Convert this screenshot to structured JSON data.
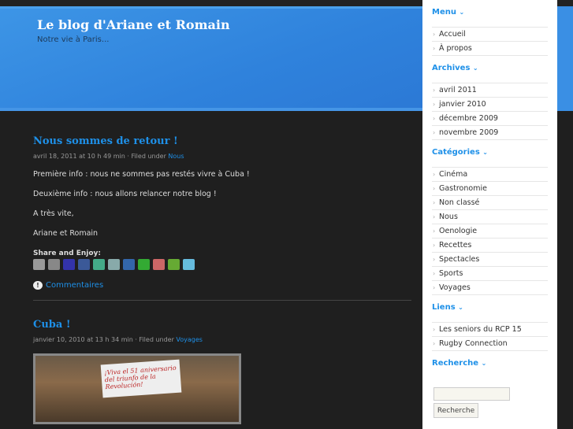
{
  "header": {
    "title": "Le blog d'Ariane et Romain",
    "tagline": "Notre vie à Paris..."
  },
  "posts": [
    {
      "title": "Nous sommes de retour !",
      "meta": "avril 18, 2011 at 10 h 49 min · Filed under ",
      "category": "Nous",
      "paragraphs": [
        "Première info : nous ne sommes pas restés vivre à Cuba !",
        "Deuxième info : nous allons relancer notre blog !",
        "A très vite,",
        "Ariane et Romain"
      ],
      "share_label": "Share and Enjoy:",
      "comments": "Commentaires"
    },
    {
      "title": "Cuba !",
      "meta": "janvier 10, 2010 at 13 h 34 min · Filed under ",
      "category": "Voyages",
      "image_caption": "¡Viva el 51 aniversario del triunfo de la Revolución!"
    }
  ],
  "share_icons": [
    {
      "name": "print",
      "color": "#999"
    },
    {
      "name": "digg",
      "color": "#888"
    },
    {
      "name": "delicious",
      "color": "#33a"
    },
    {
      "name": "facebook",
      "color": "#3b5998"
    },
    {
      "name": "google",
      "color": "#4a8"
    },
    {
      "name": "email",
      "color": "#8aa"
    },
    {
      "name": "myspace",
      "color": "#36a"
    },
    {
      "name": "add",
      "color": "#3a3"
    },
    {
      "name": "pdf",
      "color": "#c66"
    },
    {
      "name": "sms",
      "color": "#6a3"
    },
    {
      "name": "twitter",
      "color": "#6bd"
    }
  ],
  "sidebar": {
    "menu": {
      "title": "Menu",
      "items": [
        "Accueil",
        "À propos"
      ]
    },
    "archives": {
      "title": "Archives",
      "items": [
        "avril 2011",
        "janvier 2010",
        "décembre 2009",
        "novembre 2009"
      ]
    },
    "categories": {
      "title": "Catégories",
      "items": [
        "Cinéma",
        "Gastronomie",
        "Non classé",
        "Nous",
        "Oenologie",
        "Recettes",
        "Spectacles",
        "Sports",
        "Voyages"
      ]
    },
    "links": {
      "title": "Liens",
      "items": [
        "Les seniors du RCP 15",
        "Rugby Connection"
      ]
    },
    "search": {
      "title": "Recherche",
      "button": "Recherche",
      "value": ""
    }
  }
}
